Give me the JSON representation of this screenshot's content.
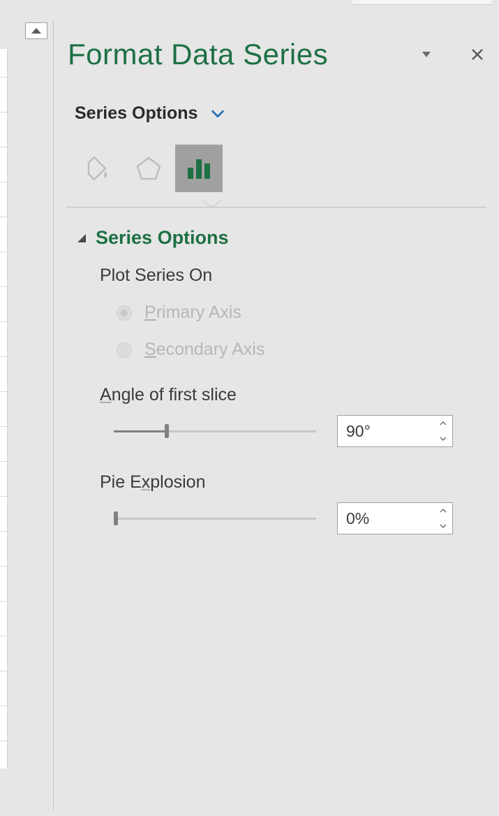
{
  "pane": {
    "title": "Format Data Series",
    "dropdown_label": "Series Options"
  },
  "tabs": {
    "fill_name": "fill-and-line-tab",
    "effects_name": "effects-tab",
    "series_name": "series-options-tab",
    "selected": "series-options-tab"
  },
  "section": {
    "title": "Series Options",
    "plot_on_label": "Plot Series On",
    "primary_axis_label": "Primary Axis",
    "secondary_axis_label": "Secondary Axis",
    "primary_checked": true,
    "angle_label": "Angle of first slice",
    "angle_value": "90°",
    "angle_slider_percent": 25,
    "explosion_label": "Pie Explosion",
    "explosion_value": "0%",
    "explosion_slider_percent": 0
  }
}
